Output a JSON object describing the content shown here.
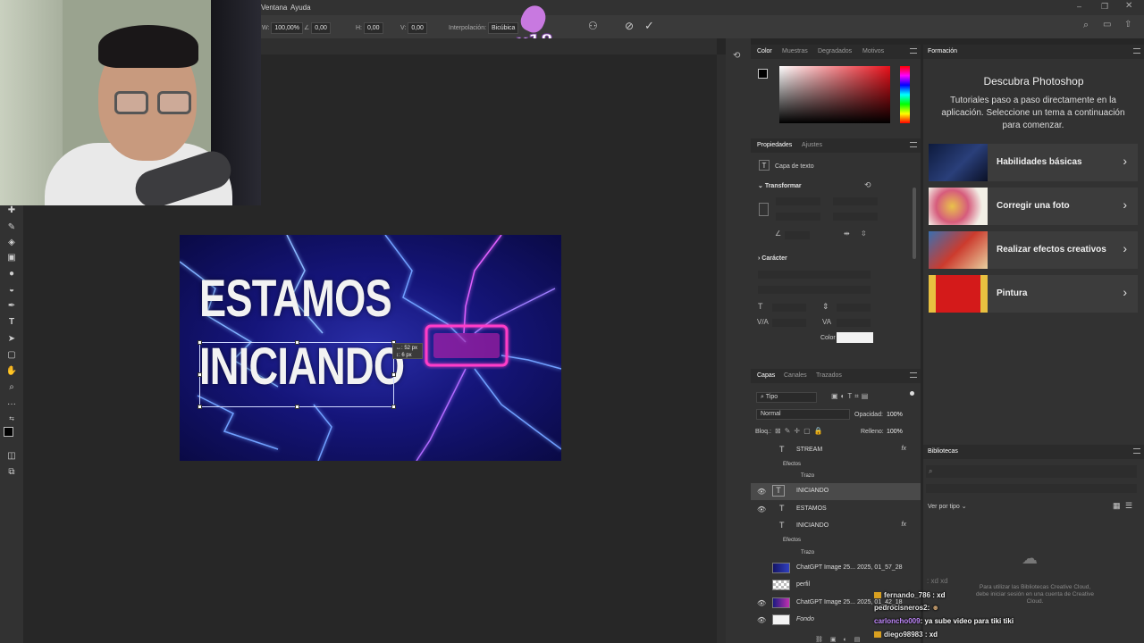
{
  "menubar": {
    "items": [
      "Ventana",
      "Ayuda"
    ]
  },
  "options_bar": {
    "zoom_w": "100,00%",
    "angle": "0,00",
    "h_label": "H:",
    "h_value": "0,00",
    "v_label": "V:",
    "v_value": "0,00",
    "interp_label": "Interpolación:",
    "interp_value": "Bicúbica"
  },
  "overlay": {
    "multiplier": "x18"
  },
  "canvas": {
    "line1": "ESTAMOS",
    "line2": "INICIANDO",
    "readout_w": "52 px",
    "readout_h": "6 px"
  },
  "color_panel": {
    "tabs": [
      "Color",
      "Muestras",
      "Degradados",
      "Motivos"
    ],
    "active_tab": "Color"
  },
  "properties_panel": {
    "tabs": [
      "Propiedades",
      "Ajustes"
    ],
    "layer_type": "Capa de texto",
    "transform_title": "Transformar",
    "character_title": "Carácter",
    "color_label": "Color",
    "color_swatch": "#f2f2f2"
  },
  "layers_panel": {
    "tabs": [
      "Capas",
      "Canales",
      "Trazados"
    ],
    "filter_label": "Tipo",
    "blend_mode": "Normal",
    "opacity_label": "Opacidad:",
    "opacity_value": "100%",
    "lock_label": "Bloq.:",
    "fill_label": "Relleno:",
    "fill_value": "100%",
    "effects_label": "Efectos",
    "stroke_label": "Trazo",
    "layers": [
      {
        "name": "STREAM",
        "kind": "text",
        "visible": false,
        "fx": "fx"
      },
      {
        "name": "INICIANDO",
        "kind": "text",
        "visible": true,
        "selected": true
      },
      {
        "name": "ESTAMOS",
        "kind": "text",
        "visible": true
      },
      {
        "name": "INICIANDO",
        "kind": "text",
        "visible": false,
        "fx": "fx"
      },
      {
        "name": "ChatGPT Image 25... 2025, 01_57_28",
        "kind": "image",
        "visible": false
      },
      {
        "name": "perfil",
        "kind": "image",
        "visible": false
      },
      {
        "name": "ChatGPT Image 25... 2025, 01_42_18",
        "kind": "image",
        "visible": true
      },
      {
        "name": "Fondo",
        "kind": "image",
        "visible": true
      }
    ]
  },
  "learn_panel": {
    "tab": "Formación",
    "title": "Descubra Photoshop",
    "description": "Tutoriales paso a paso directamente en la aplicación. Seleccione un tema a continuación para comenzar.",
    "tutorials": [
      {
        "title": "Habilidades básicas"
      },
      {
        "title": "Corregir una foto"
      },
      {
        "title": "Realizar efectos creativos"
      },
      {
        "title": "Pintura"
      }
    ]
  },
  "libraries_panel": {
    "tab": "Bibliotecas",
    "view_by": "Ver por tipo",
    "cc_message": "Para utilizar las Bibliotecas Creative Cloud, debe iniciar sesión en una cuenta de Creative Cloud."
  },
  "chat": {
    "messages": [
      {
        "user": "fernando_786",
        "text": ": xd",
        "color": "#e6e6e6",
        "badge": true
      },
      {
        "user": "pedrocisneros2",
        "text": ":",
        "color": "#e6e6e6",
        "badge": false
      },
      {
        "user": "carloncho009",
        "text": ": ya sube video para tiki tiki",
        "color": "#c38bff",
        "badge": false
      },
      {
        "user": "diego98983",
        "text": ": xd",
        "color": "#e6e6e6",
        "badge": true
      }
    ],
    "ghost_line": ": xd xd"
  }
}
